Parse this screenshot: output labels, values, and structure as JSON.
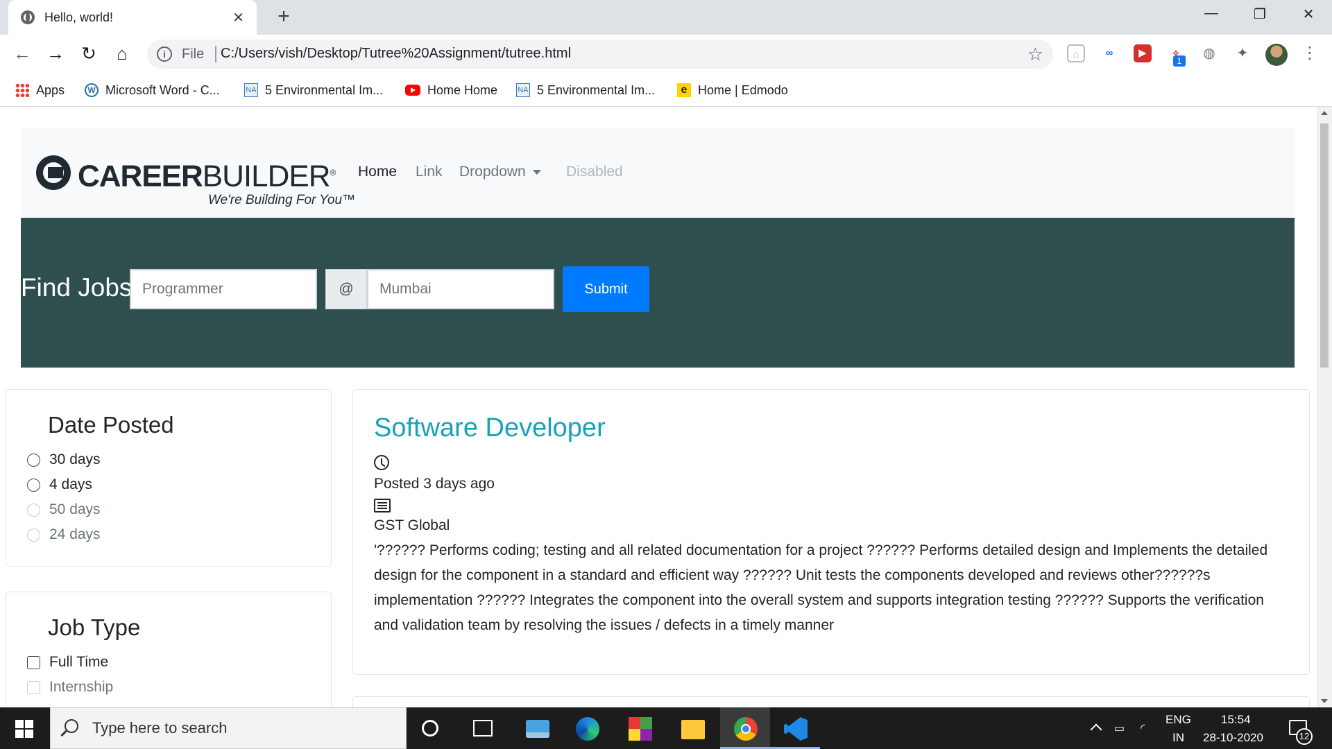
{
  "browser": {
    "tab_title": "Hello, world!",
    "tab_close": "✕",
    "new_tab": "+",
    "window_controls": {
      "minimize": "—",
      "restore": "❐",
      "close": "✕"
    },
    "nav": {
      "back": "←",
      "forward": "→",
      "reload": "↻",
      "home": "⌂"
    },
    "address": {
      "scheme": "File",
      "url": "C:/Users/vish/Desktop/Tutree%20Assignment/tutree.html"
    },
    "extension_badge": "1",
    "bookmarks": [
      {
        "label": "Apps",
        "icon": "apps-grid-icon"
      },
      {
        "label": "Microsoft Word - C...",
        "icon": "wordpress-icon"
      },
      {
        "label": "5 Environmental Im...",
        "icon": "na-icon"
      },
      {
        "label": "Home Home",
        "icon": "youtube-icon"
      },
      {
        "label": "5 Environmental Im...",
        "icon": "na-icon"
      },
      {
        "label": "Home | Edmodo",
        "icon": "edmodo-icon"
      }
    ]
  },
  "site": {
    "logo": {
      "bold": "CAREER",
      "light": "BUILDER",
      "mark": "®",
      "tagline": "We're Building For You™"
    },
    "nav": {
      "home": "Home",
      "link": "Link",
      "dropdown": "Dropdown",
      "disabled": "Disabled"
    },
    "search": {
      "title": "Find Jobs",
      "job_placeholder": "Programmer",
      "at": "@",
      "location_placeholder": "Mumbai",
      "submit": "Submit"
    },
    "filters": {
      "date_posted": {
        "title": "Date Posted",
        "options": [
          "30 days",
          "4 days",
          "50 days",
          "24 days"
        ]
      },
      "job_type": {
        "title": "Job Type",
        "options": [
          "Full Time",
          "Internship"
        ]
      }
    },
    "job": {
      "title": "Software Developer",
      "posted": "Posted 3 days ago",
      "company": "GST Global",
      "description": "'?????? Performs coding; testing and all related documentation for a project ?????? Performs detailed design and Implements the detailed design for the component in a standard and efficient way ?????? Unit tests the components developed and reviews other??????s implementation ?????? Integrates the component into the overall system and supports integration testing ?????? Supports the verification and validation team by resolving the issues / defects in a timely manner"
    }
  },
  "taskbar": {
    "search_placeholder": "Type here to search",
    "lang_top": "ENG",
    "lang_bottom": "IN",
    "time": "15:54",
    "date": "28-10-2020",
    "notifications": "12"
  }
}
